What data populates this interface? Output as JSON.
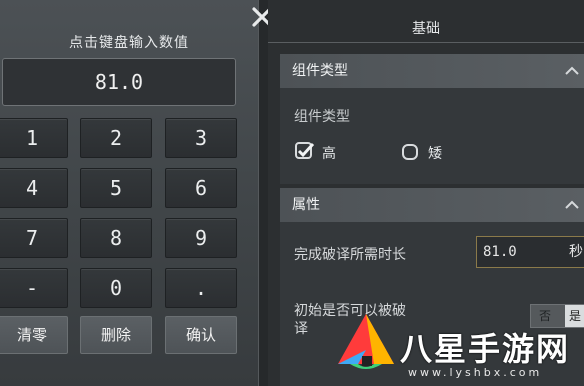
{
  "keypad": {
    "title": "点击键盘输入数值",
    "display_value": "81.0",
    "keys": [
      "1",
      "2",
      "3",
      "4",
      "5",
      "6",
      "7",
      "8",
      "9",
      "-",
      "0",
      "."
    ],
    "clear_label": "清零",
    "delete_label": "删除",
    "confirm_label": "确认"
  },
  "panel": {
    "title": "基础",
    "component_section": {
      "header": "组件类型",
      "label": "组件类型",
      "options": [
        {
          "label": "高",
          "checked": true
        },
        {
          "label": "矮",
          "checked": false
        }
      ]
    },
    "attribute_section": {
      "header": "属性",
      "crack_time_label": "完成破译所需时长",
      "crack_time_value": "81.0",
      "crack_time_suffix": "秒",
      "can_be_cracked_label_line1": "初始是否可以被破",
      "can_be_cracked_label_line2": "译",
      "toggle_options": [
        "否",
        "是"
      ]
    }
  },
  "watermark": {
    "text": "八星手游网",
    "url": "www.lyshbx.com"
  },
  "colors": {
    "accent_border": "#8b7a4a",
    "panel_bg": "#2c2f31",
    "header_bg": "#5a5f63"
  }
}
